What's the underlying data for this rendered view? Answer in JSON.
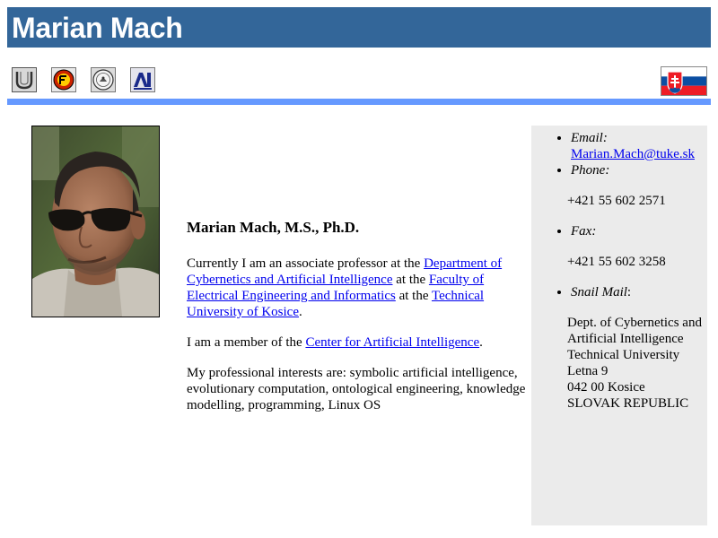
{
  "header": {
    "title": "Marian Mach"
  },
  "logos": [
    {
      "name": "tuke-logo-icon"
    },
    {
      "name": "fei-logo-icon"
    },
    {
      "name": "kkui-seal-icon"
    },
    {
      "name": "cai-logo-icon"
    }
  ],
  "colors": {
    "header_bg": "#336699",
    "divider": "#6699ff",
    "sidebar_bg": "#ebebeb",
    "link": "#0000ee"
  },
  "main": {
    "name_heading": "Marian Mach, M.S., Ph.D.",
    "p1": {
      "t1": "Currently I am an associate professor at the ",
      "link1": "Department of Cybernetics and Artificial Intelligence",
      "t2": " at the ",
      "link2": "Faculty of Electrical Engineering and Informatics",
      "t3": " at the ",
      "link3": "Technical University of Kosice",
      "t4": "."
    },
    "p2": {
      "t1": "I am a member of the ",
      "link1": "Center for Artificial Intelligence",
      "t2": "."
    },
    "p3": "My professional interests are: symbolic artificial intelligence, evolutionary computation, ontological engineering, knowledge modelling, programming, Linux OS"
  },
  "contact": {
    "email_label": "Email:",
    "email_value": "Marian.Mach@tuke.sk",
    "phone_label": "Phone:",
    "phone_value": "+421 55 602 2571",
    "fax_label": "Fax:",
    "fax_value": "+421 55 602 3258",
    "mail_label": "Snail Mail",
    "mail_colon": ":",
    "mail_lines": [
      "Dept. of Cybernetics and Artificial Intelligence",
      "Technical University",
      "Letna 9",
      "042 00 Kosice",
      "SLOVAK REPUBLIC"
    ]
  }
}
